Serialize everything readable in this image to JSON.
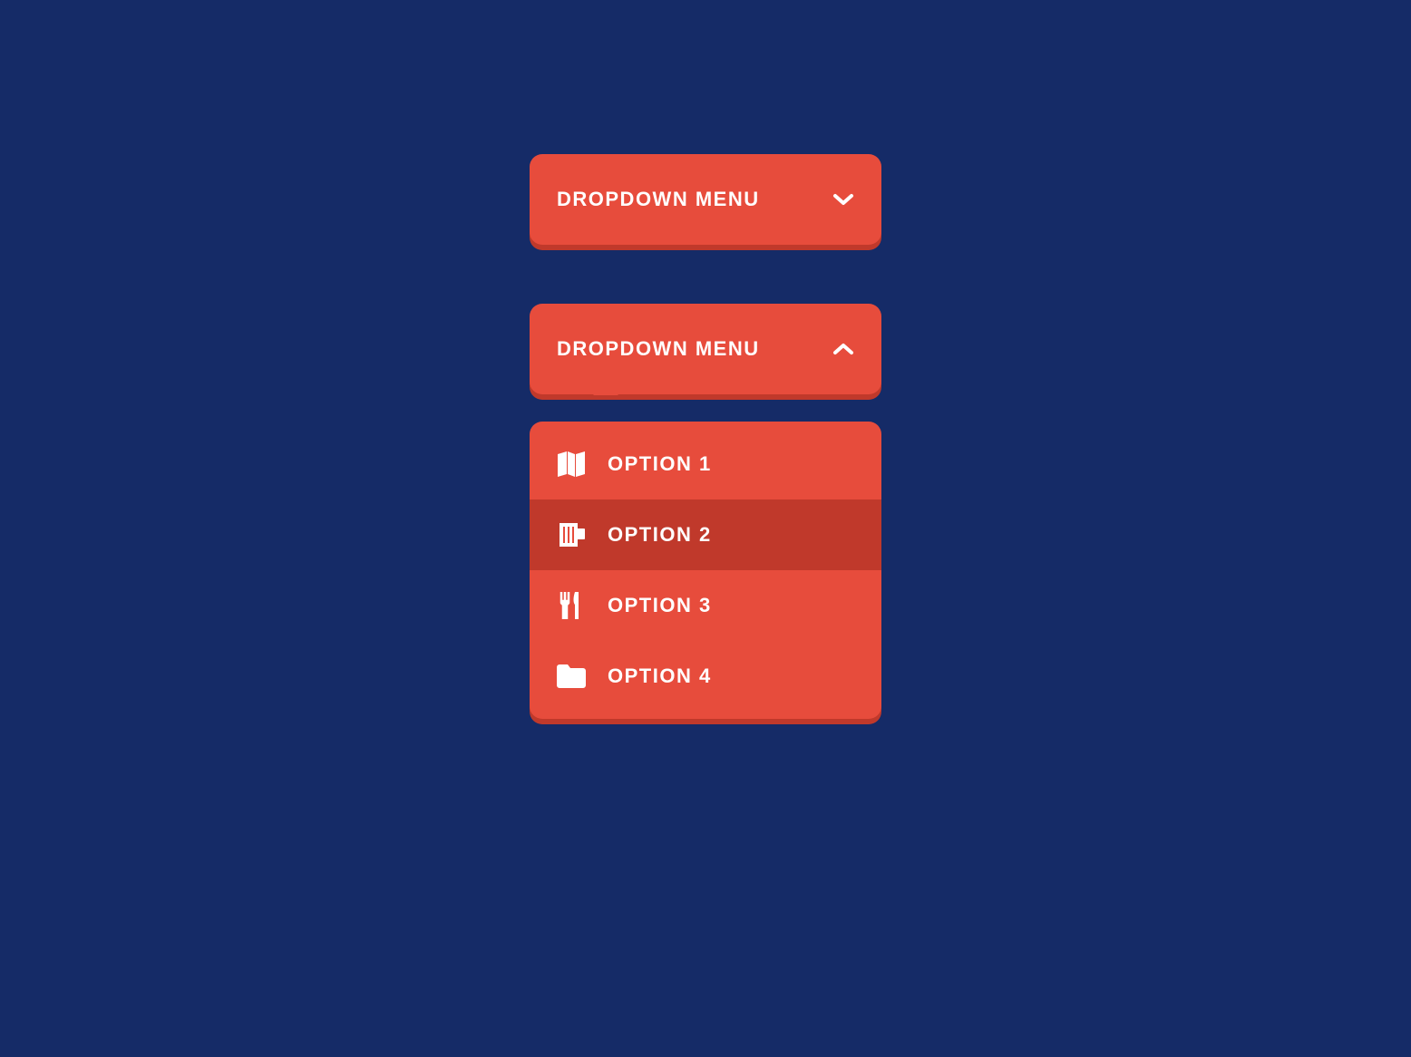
{
  "dropdown_closed": {
    "label": "DROPDOWN MENU"
  },
  "dropdown_open": {
    "label": "DROPDOWN MENU",
    "options": [
      {
        "label": "OPTION 1",
        "icon": "map-icon",
        "active": false
      },
      {
        "label": "OPTION 2",
        "icon": "beer-icon",
        "active": true
      },
      {
        "label": "OPTION 3",
        "icon": "utensils-icon",
        "active": false
      },
      {
        "label": "OPTION 4",
        "icon": "folder-icon",
        "active": false
      }
    ]
  },
  "colors": {
    "background": "#152b67",
    "primary": "#e74c3c",
    "primary_dark": "#c0392b",
    "text": "#ffffff"
  }
}
